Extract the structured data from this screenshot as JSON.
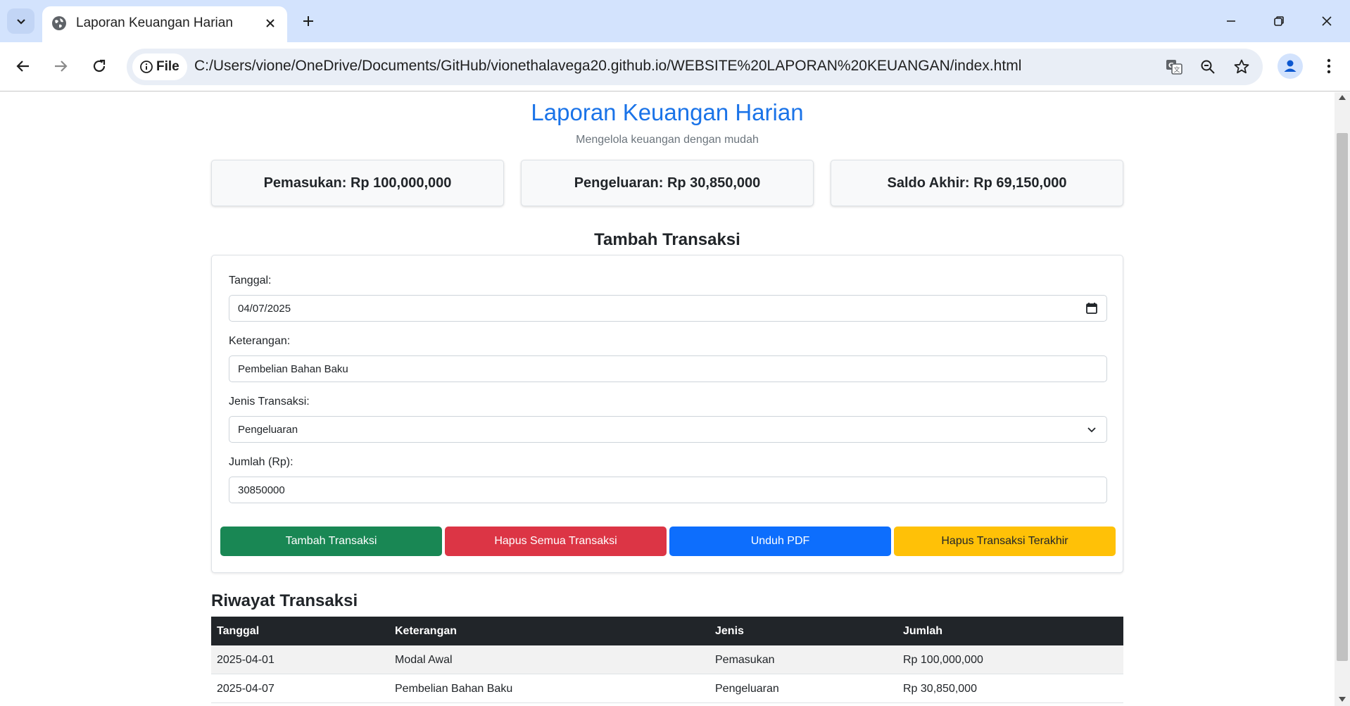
{
  "browser": {
    "tab_title": "Laporan Keuangan Harian",
    "chip_label": "File",
    "url": "C:/Users/vione/OneDrive/Documents/GitHub/vionethalavega20.github.io/WEBSITE%20LAPORAN%20KEUANGAN/index.html"
  },
  "page": {
    "title": "Laporan Keuangan Harian",
    "subtitle": "Mengelola keuangan dengan mudah"
  },
  "summary": {
    "income": "Pemasukan: Rp 100,000,000",
    "expense": "Pengeluaran: Rp 30,850,000",
    "balance": "Saldo Akhir: Rp 69,150,000"
  },
  "form": {
    "section_title": "Tambah Transaksi",
    "date_label": "Tanggal:",
    "date_value": "04/07/2025",
    "desc_label": "Keterangan:",
    "desc_value": "Pembelian Bahan Baku",
    "type_label": "Jenis Transaksi:",
    "type_value": "Pengeluaran",
    "amount_label": "Jumlah (Rp):",
    "amount_value": "30850000",
    "buttons": {
      "add": "Tambah Transaksi",
      "clear_all": "Hapus Semua Transaksi",
      "download_pdf": "Unduh PDF",
      "delete_last": "Hapus Transaksi Terakhir"
    }
  },
  "history": {
    "title": "Riwayat Transaksi",
    "headers": [
      "Tanggal",
      "Keterangan",
      "Jenis",
      "Jumlah"
    ],
    "rows": [
      [
        "2025-04-01",
        "Modal Awal",
        "Pemasukan",
        "Rp 100,000,000"
      ],
      [
        "2025-04-07",
        "Pembelian Bahan Baku",
        "Pengeluaran",
        "Rp 30,850,000"
      ]
    ]
  },
  "colors": {
    "title_blue": "#1a73e8",
    "success": "#198754",
    "danger": "#dc3545",
    "primary": "#0d6efd",
    "warning": "#ffc107",
    "table_header": "#212529"
  },
  "icons": [
    "tab-search-icon",
    "globe-icon",
    "close-icon",
    "plus-icon",
    "minimize-icon",
    "restore-icon",
    "window-close-icon",
    "back-icon",
    "forward-icon",
    "reload-icon",
    "info-icon",
    "translate-icon",
    "zoom-icon",
    "star-icon",
    "profile-icon",
    "kebab-menu-icon",
    "calendar-icon",
    "chevron-down-icon"
  ]
}
